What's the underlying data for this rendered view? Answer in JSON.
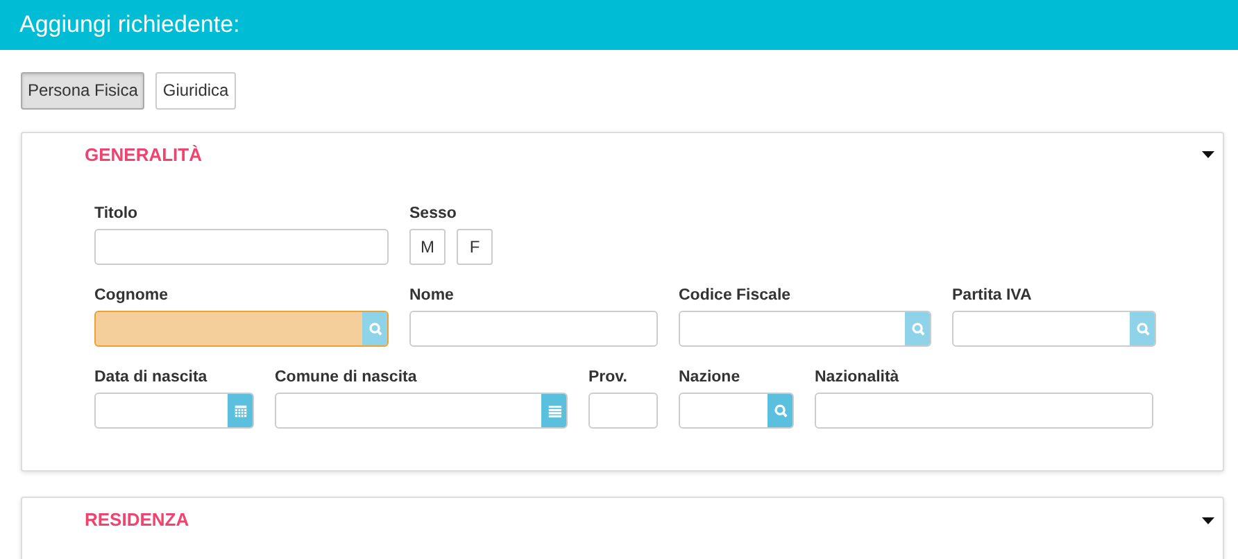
{
  "header": {
    "title": "Aggiungi richiedente:"
  },
  "type_buttons": [
    {
      "label": "Persona Fisica",
      "selected": true
    },
    {
      "label": "Giuridica",
      "selected": false
    }
  ],
  "sections": [
    {
      "title": "GENERALITÀ",
      "expanded": true,
      "lines": [
        {
          "fields": [
            {
              "label": "Titolo",
              "kind": "text",
              "highlighted": false
            },
            {
              "label": "Sesso",
              "kind": "choice",
              "options": [
                {
                  "label": "M",
                  "selected": false
                },
                {
                  "label": "F",
                  "selected": false
                }
              ]
            }
          ]
        },
        {
          "fields": [
            {
              "label": "Cognome",
              "kind": "text",
              "highlighted": true,
              "addon": {
                "kind": "search",
                "disabled": true
              }
            },
            {
              "label": "Nome",
              "kind": "text",
              "highlighted": false
            },
            {
              "label": "Codice Fiscale",
              "kind": "text",
              "highlighted": false,
              "addon": {
                "kind": "search",
                "disabled": true
              }
            },
            {
              "label": "Partita IVA",
              "kind": "text",
              "highlighted": false,
              "addon": {
                "kind": "search",
                "disabled": true
              }
            }
          ]
        },
        {
          "fields": [
            {
              "label": "Data di nascita",
              "kind": "text",
              "highlighted": false,
              "addon": {
                "kind": "calendar",
                "disabled": false
              }
            },
            {
              "label": "Comune di nascita",
              "kind": "text",
              "highlighted": false,
              "addon": {
                "kind": "list",
                "disabled": false
              }
            },
            {
              "label": "Prov.",
              "kind": "text",
              "highlighted": false
            },
            {
              "label": "Nazione",
              "kind": "text",
              "highlighted": false,
              "addon": {
                "kind": "search",
                "disabled": false
              }
            },
            {
              "label": "Nazionalità",
              "kind": "text",
              "highlighted": false
            }
          ]
        }
      ]
    },
    {
      "title": "RESIDENZA",
      "expanded": true
    }
  ]
}
